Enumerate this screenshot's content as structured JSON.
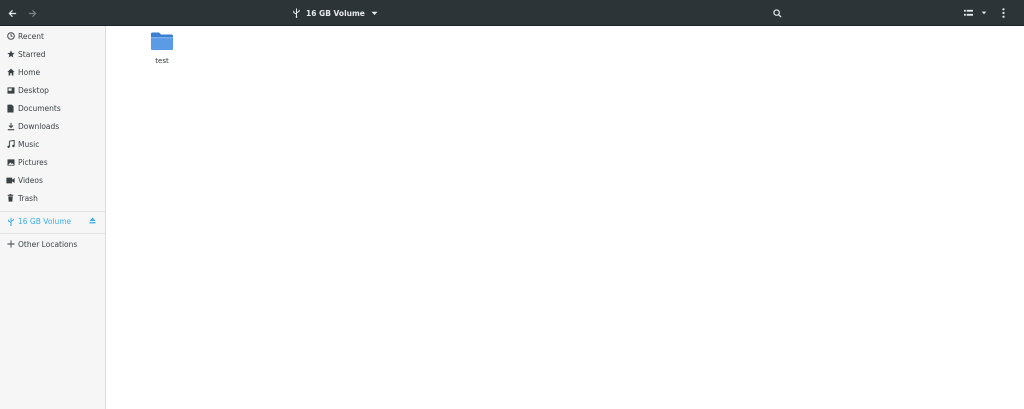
{
  "header": {
    "location_label": "16 GB Volume"
  },
  "sidebar": {
    "items": [
      {
        "label": "Recent",
        "icon": "clock-icon"
      },
      {
        "label": "Starred",
        "icon": "star-icon"
      },
      {
        "label": "Home",
        "icon": "home-icon"
      },
      {
        "label": "Desktop",
        "icon": "desktop-icon"
      },
      {
        "label": "Documents",
        "icon": "document-icon"
      },
      {
        "label": "Downloads",
        "icon": "download-icon"
      },
      {
        "label": "Music",
        "icon": "music-icon"
      },
      {
        "label": "Pictures",
        "icon": "picture-icon"
      },
      {
        "label": "Videos",
        "icon": "video-icon"
      },
      {
        "label": "Trash",
        "icon": "trash-icon"
      }
    ],
    "devices": [
      {
        "label": "16 GB Volume",
        "icon": "usb-icon",
        "active": true
      }
    ],
    "other": {
      "label": "Other Locations",
      "icon": "plus-icon"
    }
  },
  "files": [
    {
      "name": "test",
      "type": "folder"
    }
  ],
  "colors": {
    "header_bg": "#2d3438",
    "accent": "#3daee9",
    "folder": "#4a90d9"
  }
}
